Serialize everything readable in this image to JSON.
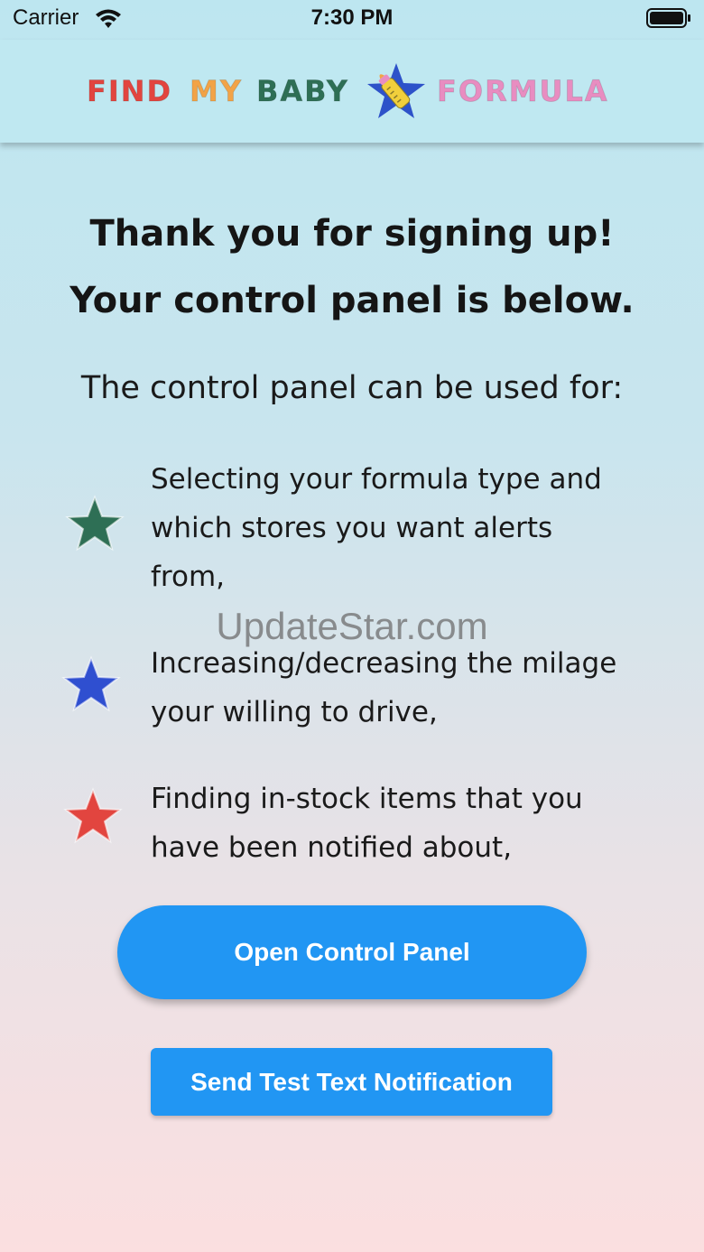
{
  "status_bar": {
    "carrier": "Carrier",
    "time": "7:30 PM",
    "wifi_icon": "wifi-icon",
    "battery_icon": "battery-full-icon"
  },
  "header": {
    "logo_words": [
      "FIND",
      "MY",
      "BABY",
      "FORMULA"
    ],
    "logo_icon": "star-baby-bottle-icon",
    "colors": {
      "find": "#e2453f",
      "my": "#f2a347",
      "baby": "#2e6f55",
      "formula": "#e88dc1"
    }
  },
  "main": {
    "heading_line1": "Thank you for signing up!",
    "heading_line2": "Your control panel is below.",
    "intro": "The control panel can be used for:",
    "features": [
      {
        "text_lines": [
          "Selecting your formula type and",
          "which stores you want alerts",
          "from,"
        ],
        "icon": "green-star-icon",
        "color": "#2e6f55"
      },
      {
        "text_lines": [
          "Increasing/decreasing the milage",
          "your willing to drive,"
        ],
        "icon": "blue-star-icon",
        "color": "#2f4fd0"
      },
      {
        "text_lines": [
          "Finding in-stock items that you",
          "have been notified about,"
        ],
        "icon": "red-star-icon",
        "color": "#e2453f"
      }
    ],
    "open_panel_label": "Open Control Panel",
    "test_notification_label": "Send Test Text Notification",
    "accent_color": "#2196f3"
  },
  "watermark": "UpdateStar.com"
}
